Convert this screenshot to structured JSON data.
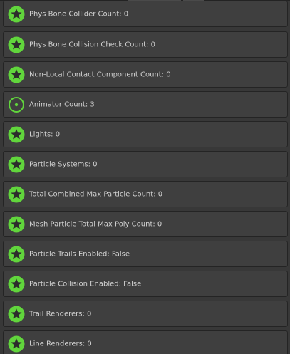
{
  "colors": {
    "star_icon_fill": "#61d53c",
    "info_icon_ring": "#61d53c",
    "row_background": "#3f3f3f",
    "row_border": "#242424",
    "text": "#d2d2d2"
  },
  "rows": [
    {
      "icon": "star-icon",
      "label": "Phys Bone Collider Count: 0"
    },
    {
      "icon": "star-icon",
      "label": "Phys Bone Collision Check Count: 0"
    },
    {
      "icon": "star-icon",
      "label": "Non-Local Contact Component Count: 0"
    },
    {
      "icon": "ring-dot-icon",
      "label": "Animator Count: 3"
    },
    {
      "icon": "star-icon",
      "label": "Lights: 0"
    },
    {
      "icon": "star-icon",
      "label": "Particle Systems: 0"
    },
    {
      "icon": "star-icon",
      "label": "Total Combined Max Particle Count: 0"
    },
    {
      "icon": "star-icon",
      "label": "Mesh Particle Total Max Poly Count: 0"
    },
    {
      "icon": "star-icon",
      "label": "Particle Trails Enabled: False"
    },
    {
      "icon": "star-icon",
      "label": "Particle Collision Enabled: False"
    },
    {
      "icon": "star-icon",
      "label": "Trail Renderers: 0"
    },
    {
      "icon": "star-icon",
      "label": "Line Renderers: 0"
    }
  ]
}
